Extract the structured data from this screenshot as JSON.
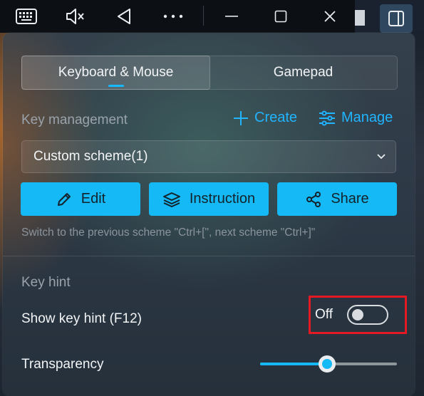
{
  "tabs": [
    {
      "label": "Keyboard & Mouse",
      "active": true
    },
    {
      "label": "Gamepad",
      "active": false
    }
  ],
  "key_management": {
    "title": "Key management",
    "create_label": "Create",
    "manage_label": "Manage",
    "scheme_selected": "Custom scheme(1)",
    "buttons": {
      "edit": "Edit",
      "instruction": "Instruction",
      "share": "Share"
    },
    "hint": "Switch to the previous scheme \"Ctrl+[\", next scheme \"Ctrl+]\""
  },
  "key_hint": {
    "title": "Key hint",
    "show_label": "Show key hint (F12)",
    "toggle_state": "Off",
    "transparency_label": "Transparency",
    "transparency_value": 0.49
  },
  "colors": {
    "accent": "#14b9f5",
    "highlight": "#e31a24"
  },
  "icons": [
    "keyboard-icon",
    "mute-icon",
    "back-icon",
    "more-icon",
    "minimize-icon",
    "maximize-icon",
    "close-icon",
    "sidebar-icon",
    "plus-icon",
    "sliders-icon",
    "pencil-icon",
    "layers-icon",
    "share-icon",
    "chevron-down-icon"
  ]
}
